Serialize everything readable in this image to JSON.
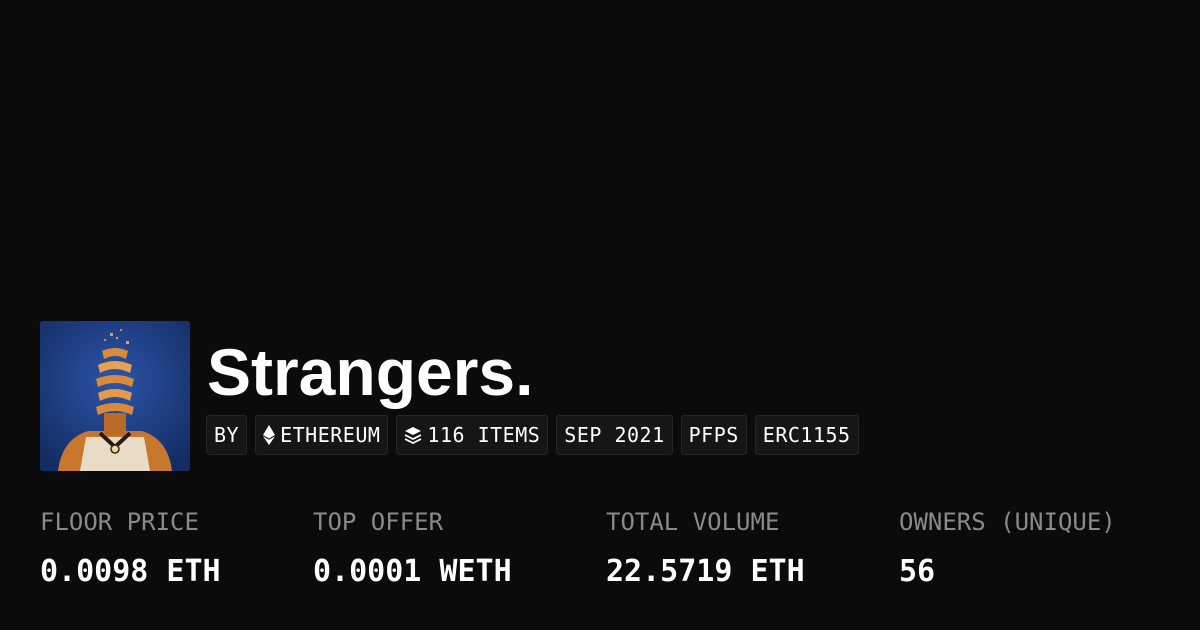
{
  "collection": {
    "title": "Strangers.",
    "avatar_icon": "avatar-image",
    "tags": [
      {
        "label": "BY",
        "icon": ""
      },
      {
        "label": "ETHEREUM",
        "icon": "ethereum-icon"
      },
      {
        "label": "116 ITEMS",
        "icon": "layers-icon"
      },
      {
        "label": "SEP 2021",
        "icon": ""
      },
      {
        "label": "PFPS",
        "icon": ""
      },
      {
        "label": "ERC1155",
        "icon": ""
      }
    ]
  },
  "stats": [
    {
      "label": "FLOOR PRICE",
      "value": "0.0098 ETH"
    },
    {
      "label": "TOP OFFER",
      "value": "0.0001 WETH"
    },
    {
      "label": "TOTAL VOLUME",
      "value": "22.5719 ETH"
    },
    {
      "label": "OWNERS (UNIQUE)",
      "value": "56"
    }
  ],
  "colors": {
    "background": "#0b0b0c",
    "tag_background": "#161617",
    "label_gray": "#8a8a8e",
    "avatar_blue": "#1d3f86",
    "avatar_orange": "#d98a3a"
  }
}
